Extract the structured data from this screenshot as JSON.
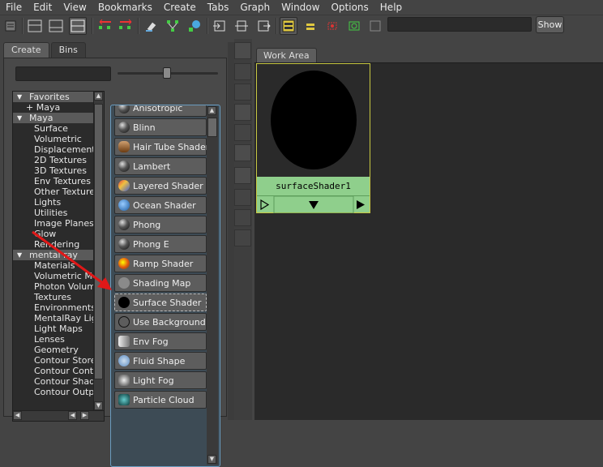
{
  "menubar": {
    "items": [
      "File",
      "Edit",
      "View",
      "Bookmarks",
      "Create",
      "Tabs",
      "Graph",
      "Window",
      "Options",
      "Help"
    ]
  },
  "toolbar": {
    "show_label": "Show",
    "search_value": ""
  },
  "left_panel": {
    "tabs": [
      "Create",
      "Bins"
    ],
    "active_tab": "Create",
    "filter_value": "",
    "tree": [
      {
        "label": "Favorites",
        "kind": "group",
        "expanded": true
      },
      {
        "label": "+ Maya",
        "kind": "sub"
      },
      {
        "label": "Maya",
        "kind": "group",
        "expanded": true
      },
      {
        "label": "Surface",
        "kind": "item"
      },
      {
        "label": "Volumetric",
        "kind": "item"
      },
      {
        "label": "Displacement",
        "kind": "item"
      },
      {
        "label": "2D Textures",
        "kind": "item"
      },
      {
        "label": "3D Textures",
        "kind": "item"
      },
      {
        "label": "Env Textures",
        "kind": "item"
      },
      {
        "label": "Other Textures",
        "kind": "item"
      },
      {
        "label": "Lights",
        "kind": "item"
      },
      {
        "label": "Utilities",
        "kind": "item"
      },
      {
        "label": "Image Planes",
        "kind": "item"
      },
      {
        "label": "Glow",
        "kind": "item"
      },
      {
        "label": "Rendering",
        "kind": "item"
      },
      {
        "label": "mental ray",
        "kind": "group",
        "expanded": true
      },
      {
        "label": "Materials",
        "kind": "item"
      },
      {
        "label": "Volumetric Ma...",
        "kind": "item"
      },
      {
        "label": "Photon Volum...",
        "kind": "item"
      },
      {
        "label": "Textures",
        "kind": "item"
      },
      {
        "label": "Environments",
        "kind": "item"
      },
      {
        "label": "MentalRay Lig...",
        "kind": "item"
      },
      {
        "label": "Light Maps",
        "kind": "item"
      },
      {
        "label": "Lenses",
        "kind": "item"
      },
      {
        "label": "Geometry",
        "kind": "item"
      },
      {
        "label": "Contour Store",
        "kind": "item"
      },
      {
        "label": "Contour Cont...",
        "kind": "item"
      },
      {
        "label": "Contour Shade...",
        "kind": "item"
      },
      {
        "label": "Contour Outpu...",
        "kind": "item"
      }
    ],
    "nodes": [
      {
        "label": "Anisotropic",
        "icon": "sphere-dark-icon",
        "color": "#555"
      },
      {
        "label": "Blinn",
        "icon": "sphere-dark-icon",
        "color": "#555"
      },
      {
        "label": "Hair Tube Shader",
        "icon": "hair-tube-icon",
        "color": "#8a5a30"
      },
      {
        "label": "Lambert",
        "icon": "sphere-dark-icon",
        "color": "#555"
      },
      {
        "label": "Layered Shader",
        "icon": "layered-shader-icon",
        "color": "#6a4aa0"
      },
      {
        "label": "Ocean Shader",
        "icon": "ocean-icon",
        "color": "#2a7ac0"
      },
      {
        "label": "Phong",
        "icon": "sphere-dark-icon",
        "color": "#555"
      },
      {
        "label": "Phong E",
        "icon": "sphere-dark-icon",
        "color": "#555"
      },
      {
        "label": "Ramp Shader",
        "icon": "ramp-icon",
        "color": "#d05020"
      },
      {
        "label": "Shading Map",
        "icon": "sphere-grey-icon",
        "color": "#888"
      },
      {
        "label": "Surface Shader",
        "icon": "sphere-black-icon",
        "color": "#000"
      },
      {
        "label": "Use Background",
        "icon": "circle-outline-icon",
        "color": "#5d5d5d"
      },
      {
        "label": "Env Fog",
        "icon": "env-fog-icon",
        "color": "#ddd"
      },
      {
        "label": "Fluid Shape",
        "icon": "fluid-icon",
        "color": "#7ab0e0"
      },
      {
        "label": "Light Fog",
        "icon": "light-fog-icon",
        "color": "#aaa"
      },
      {
        "label": "Particle Cloud",
        "icon": "particle-icon",
        "color": "#2a8a8a"
      }
    ],
    "selected_node": "Surface Shader"
  },
  "work_area": {
    "tab_label": "Work Area",
    "node_name": "surfaceShader1",
    "swatch_color": "#000000",
    "node_color": "#8fcf8c",
    "highlight_color": "#c8c842"
  },
  "annotation": {
    "color": "#e01818"
  }
}
